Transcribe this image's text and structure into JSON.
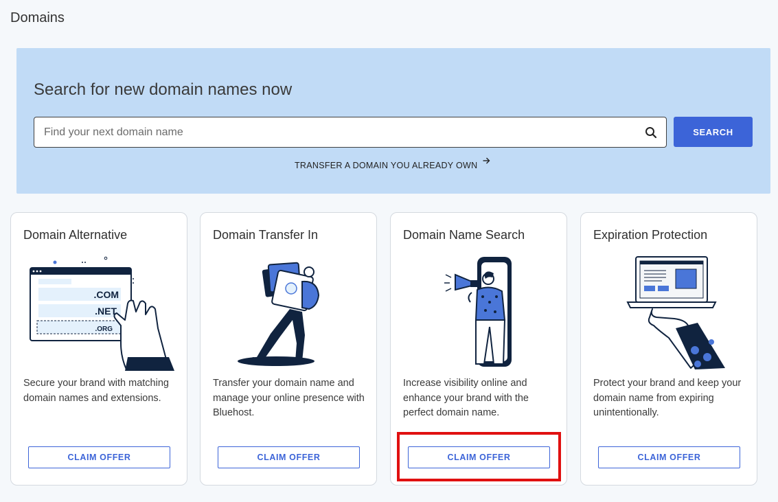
{
  "page": {
    "title": "Domains"
  },
  "search": {
    "heading": "Search for new domain names now",
    "placeholder": "Find your next domain name",
    "value": "",
    "button_label": "SEARCH",
    "transfer_link": "TRANSFER A DOMAIN YOU ALREADY OWN"
  },
  "cards": [
    {
      "title": "Domain Alternative",
      "description": "Secure your brand with matching domain names and extensions.",
      "button_label": "CLAIM OFFER",
      "illustration": {
        "extensions": [
          ".COM",
          ".NET",
          ".ORG"
        ]
      }
    },
    {
      "title": "Domain Transfer In",
      "description": "Transfer your domain name and manage your online presence with Bluehost.",
      "button_label": "CLAIM OFFER"
    },
    {
      "title": "Domain Name Search",
      "description": "Increase visibility online and enhance your brand with the perfect domain name.",
      "button_label": "CLAIM OFFER",
      "highlighted": true
    },
    {
      "title": "Expiration Protection",
      "description": "Protect your brand and keep your domain name from expiring unintentionally.",
      "button_label": "CLAIM OFFER"
    }
  ],
  "colors": {
    "accent": "#3c64d8",
    "panel": "#c1dbf6",
    "highlight": "#e01010",
    "illustration_dark": "#10233f",
    "illustration_blue": "#4a76d8",
    "illustration_light": "#e4f1fc"
  }
}
